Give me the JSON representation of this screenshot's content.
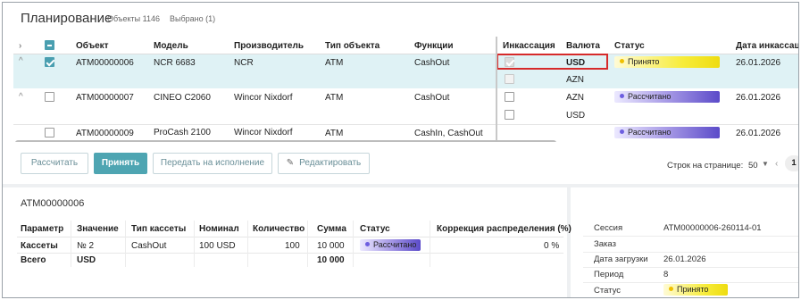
{
  "header": {
    "title": "Планирование",
    "objects_count": "Объекты 1146",
    "selected_count": "Выбрано (1)"
  },
  "grid": {
    "columns": [
      "Объект",
      "Модель",
      "Производитель",
      "Тип объекта",
      "Функции",
      "Инкассация",
      "Валюта",
      "Статус",
      "Дата инкассации"
    ],
    "rows": [
      {
        "object": "ATM00000006",
        "model": "NCR 6683",
        "vendor": "NCR",
        "type": "ATM",
        "functions": "CashOut",
        "currencies": [
          "USD",
          "AZN"
        ],
        "status": "Принято",
        "date": "26.01.2026"
      },
      {
        "object": "ATM00000007",
        "model": "CINEO C2060",
        "vendor": "Wincor Nixdorf",
        "type": "ATM",
        "functions": "CashOut",
        "currencies": [
          "AZN",
          "USD"
        ],
        "status": "Рассчитано",
        "date": "26.01.2026"
      },
      {
        "object": "ATM00000009",
        "model": "ProCash 2100",
        "vendor": "Wincor Nixdorf",
        "type": "ATM",
        "functions": "CashIn, CashOut",
        "status": "Рассчитано",
        "date": "26.01.2026"
      }
    ]
  },
  "toolbar": {
    "calculate": "Рассчитать",
    "accept": "Принять",
    "send_to_execution": "Передать на исполнение",
    "edit": "Редактировать",
    "rows_per_page_label": "Строк на странице:",
    "rows_per_page_value": "50",
    "current_page": "1"
  },
  "detail": {
    "title": "ATM00000006",
    "columns": [
      "Параметр",
      "Значение",
      "Тип кассеты",
      "Номинал",
      "Количество",
      "Сумма",
      "Статус",
      "Коррекция распределения (%)"
    ],
    "rows": [
      {
        "param": "Кассеты",
        "value": "№ 2",
        "cassette_type": "CashOut",
        "nominal": "100 USD",
        "quantity": "100",
        "sum": "10 000",
        "status": "Рассчитано",
        "correction": "0 %"
      },
      {
        "param": "Всего",
        "value": "USD",
        "sum": "10 000"
      }
    ]
  },
  "info": {
    "items": [
      {
        "label": "Сессия",
        "value": "ATM00000006-260114-01"
      },
      {
        "label": "Заказ",
        "value": ""
      },
      {
        "label": "Дата загрузки",
        "value": "26.01.2026"
      },
      {
        "label": "Период",
        "value": "8"
      },
      {
        "label": "Статус",
        "value": "Принято"
      }
    ]
  },
  "colors": {
    "accent": "#4ea5b2",
    "selected_row": "#dff2f5",
    "status_accepted": "#f7ec3a",
    "status_calculated": "#5b4bc9",
    "highlight_box": "#d62a2a"
  }
}
